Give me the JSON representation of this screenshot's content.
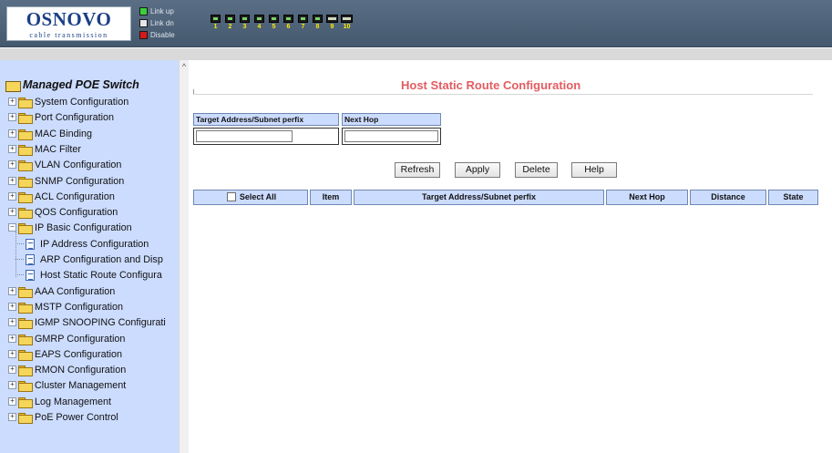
{
  "colors": {
    "header_bg": "#4f6379",
    "sidebar_bg": "#ccdcff",
    "title_red": "#e35c61",
    "link_up": "#3ccf3c",
    "link_down": "#e6e6e6",
    "disable": "#d61818",
    "port_yellow": "#ffe900"
  },
  "logo": {
    "name": "OSNOVO",
    "subtitle": "cable transmission"
  },
  "legend": [
    {
      "label": "Link up",
      "color": "#3ccf3c"
    },
    {
      "label": "Link dn",
      "color": "#e6e6e6"
    },
    {
      "label": "Disable",
      "color": "#d61818"
    }
  ],
  "ports": [
    "1",
    "2",
    "3",
    "4",
    "5",
    "6",
    "7",
    "8",
    "9",
    "10"
  ],
  "sidebar": {
    "root": "Managed POE Switch",
    "items": [
      {
        "label": "System Configuration",
        "expander": "+"
      },
      {
        "label": "Port Configuration",
        "expander": "+"
      },
      {
        "label": "MAC Binding",
        "expander": "+"
      },
      {
        "label": "MAC Filter",
        "expander": "+"
      },
      {
        "label": "VLAN Configuration",
        "expander": "+"
      },
      {
        "label": "SNMP Configuration",
        "expander": "+"
      },
      {
        "label": "ACL Configuration",
        "expander": "+"
      },
      {
        "label": "QOS Configuration",
        "expander": "+"
      },
      {
        "label": "IP Basic Configuration",
        "expander": "−"
      }
    ],
    "children": [
      {
        "label": "IP Address Configuration"
      },
      {
        "label": "ARP Configuration and Disp"
      },
      {
        "label": "Host Static Route Configura"
      }
    ],
    "items_after": [
      {
        "label": "AAA Configuration",
        "expander": "+"
      },
      {
        "label": "MSTP Configuration",
        "expander": "+"
      },
      {
        "label": "IGMP SNOOPING Configurati",
        "expander": "+"
      },
      {
        "label": "GMRP Configuration",
        "expander": "+"
      },
      {
        "label": "EAPS Configuration",
        "expander": "+"
      },
      {
        "label": "RMON Configuration",
        "expander": "+"
      },
      {
        "label": "Cluster Management",
        "expander": "+"
      },
      {
        "label": "Log Management",
        "expander": "+"
      },
      {
        "label": "PoE Power Control",
        "expander": "+"
      }
    ]
  },
  "main": {
    "title": "Host Static Route Configuration",
    "form": {
      "target_label": "Target Address/Subnet perfix",
      "nexthop_label": "Next Hop",
      "target_value": "",
      "nexthop_value": ""
    },
    "buttons": {
      "refresh": "Refresh",
      "apply": "Apply",
      "delete": "Delete",
      "help": "Help"
    },
    "table_headers": {
      "select_all": "Select All",
      "item": "Item",
      "target": "Target Address/Subnet perfix",
      "next_hop": "Next Hop",
      "distance": "Distance",
      "state": "State"
    }
  }
}
